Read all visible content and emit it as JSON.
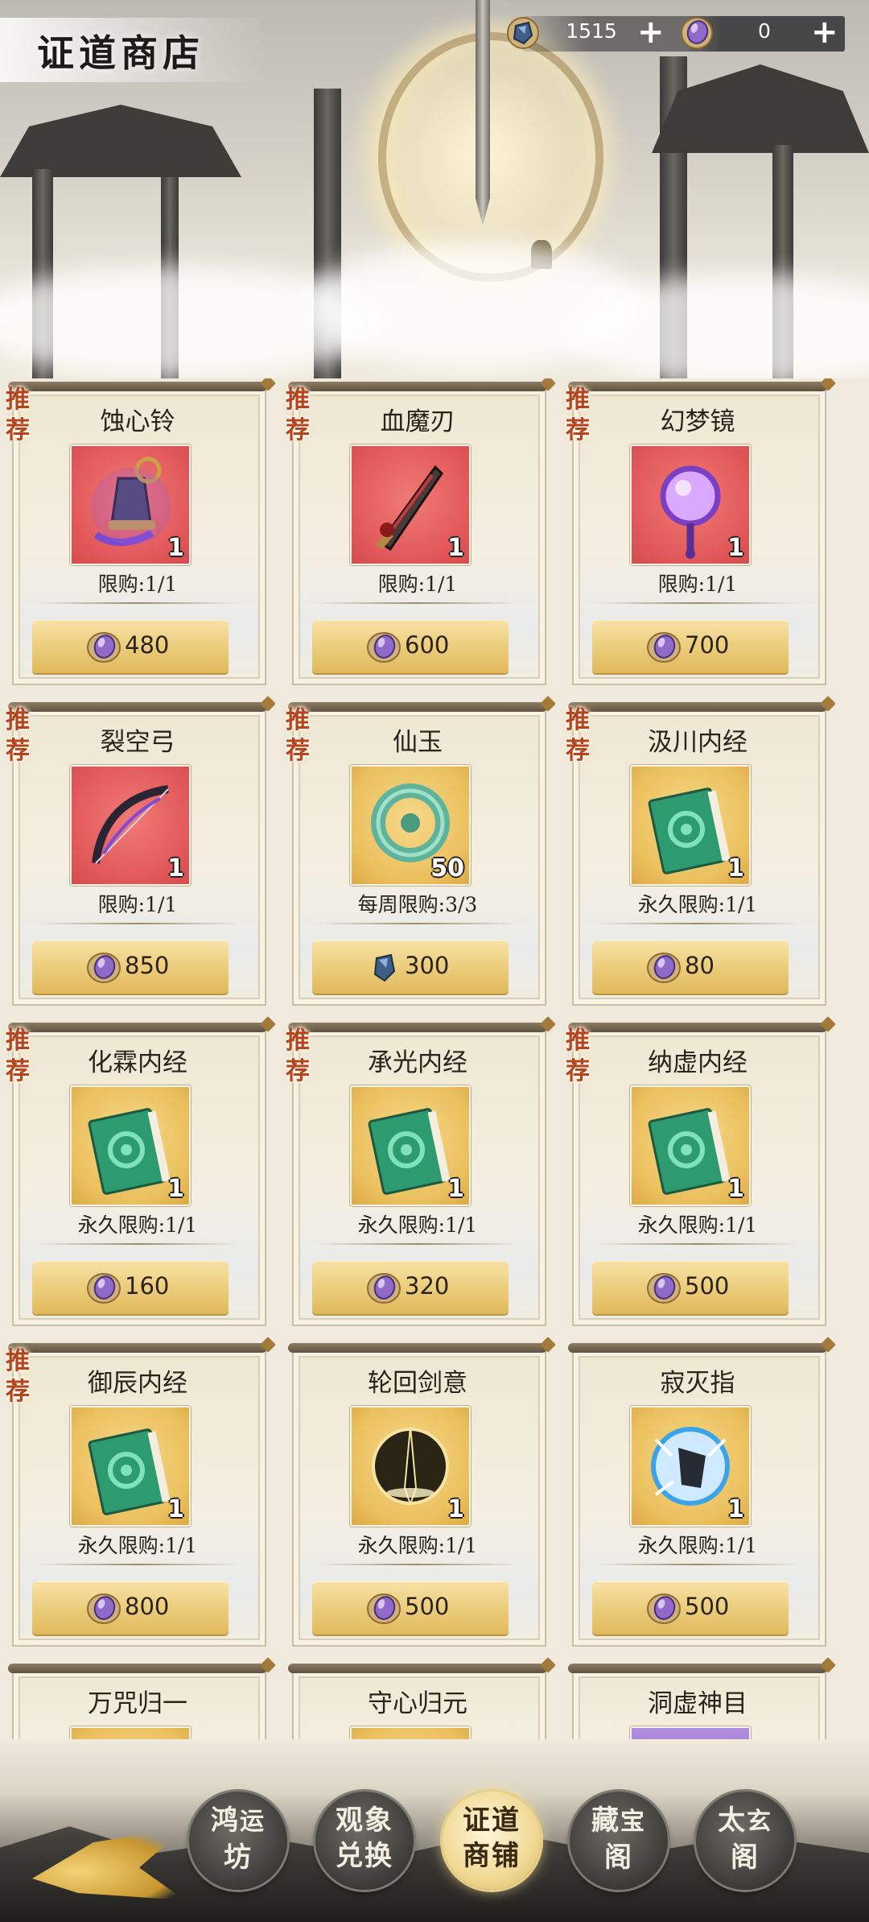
{
  "header": {
    "title": "证道商店",
    "currency_blue": {
      "value": "1515",
      "plus": "+",
      "icon": "blue-stone-icon"
    },
    "currency_purple": {
      "value": "0",
      "plus": "+",
      "icon": "purple-crystal-icon"
    }
  },
  "items": [
    {
      "badge": "推荐",
      "name": "蚀心铃",
      "qty": "1",
      "limit": "限购:1/1",
      "price": "480",
      "bg": "red",
      "art": "bell",
      "cur": "purple"
    },
    {
      "badge": "推荐",
      "name": "血魔刃",
      "qty": "1",
      "limit": "限购:1/1",
      "price": "600",
      "bg": "red",
      "art": "blade",
      "cur": "purple"
    },
    {
      "badge": "推荐",
      "name": "幻梦镜",
      "qty": "1",
      "limit": "限购:1/1",
      "price": "700",
      "bg": "red",
      "art": "mirror",
      "cur": "purple"
    },
    {
      "badge": "推荐",
      "name": "裂空弓",
      "qty": "1",
      "limit": "限购:1/1",
      "price": "850",
      "bg": "red",
      "art": "bow",
      "cur": "purple"
    },
    {
      "badge": "推荐",
      "name": "仙玉",
      "qty": "50",
      "limit": "每周限购:3/3",
      "price": "300",
      "bg": "gold",
      "art": "jade",
      "cur": "blue"
    },
    {
      "badge": "推荐",
      "name": "汲川内经",
      "qty": "1",
      "limit": "永久限购:1/1",
      "price": "80",
      "bg": "gold",
      "art": "book",
      "cur": "purple"
    },
    {
      "badge": "推荐",
      "name": "化霖内经",
      "qty": "1",
      "limit": "永久限购:1/1",
      "price": "160",
      "bg": "gold",
      "art": "book",
      "cur": "purple"
    },
    {
      "badge": "推荐",
      "name": "承光内经",
      "qty": "1",
      "limit": "永久限购:1/1",
      "price": "320",
      "bg": "gold",
      "art": "book",
      "cur": "purple"
    },
    {
      "badge": "推荐",
      "name": "纳虚内经",
      "qty": "1",
      "limit": "永久限购:1/1",
      "price": "500",
      "bg": "gold",
      "art": "book",
      "cur": "purple"
    },
    {
      "badge": "推荐",
      "name": "御辰内经",
      "qty": "1",
      "limit": "永久限购:1/1",
      "price": "800",
      "bg": "gold",
      "art": "book",
      "cur": "purple"
    },
    {
      "badge": "",
      "name": "轮回剑意",
      "qty": "1",
      "limit": "永久限购:1/1",
      "price": "500",
      "bg": "gold",
      "art": "sword-orb",
      "cur": "purple"
    },
    {
      "badge": "",
      "name": "寂灭指",
      "qty": "1",
      "limit": "永久限购:1/1",
      "price": "500",
      "bg": "gold",
      "art": "finger-orb",
      "cur": "purple"
    },
    {
      "badge": "",
      "name": "万咒归一",
      "qty": "",
      "limit": "",
      "price": "",
      "bg": "gold",
      "art": "",
      "cur": ""
    },
    {
      "badge": "",
      "name": "守心归元",
      "qty": "",
      "limit": "",
      "price": "",
      "bg": "gold",
      "art": "",
      "cur": ""
    },
    {
      "badge": "",
      "name": "洞虚神目",
      "qty": "",
      "limit": "",
      "price": "",
      "bg": "purple",
      "art": "",
      "cur": ""
    }
  ],
  "nav": [
    {
      "line1": "鸿",
      "line1b": "运",
      "line2": "坊",
      "active": false
    },
    {
      "line1": "观象",
      "line1b": "",
      "line2": "兑换",
      "active": false
    },
    {
      "line1": "证道",
      "line1b": "",
      "line2": "商铺",
      "active": true
    },
    {
      "line1": "藏",
      "line1b": "宝",
      "line2": "阁",
      "active": false
    },
    {
      "line1": "太",
      "line1b": "玄",
      "line2": "阁",
      "active": false
    }
  ],
  "colors": {
    "accent_gold": "#e1b95c",
    "badge_red": "#b5441c",
    "crystal_purple": "#8f6ac9",
    "stone_blue": "#4a6f9c"
  }
}
